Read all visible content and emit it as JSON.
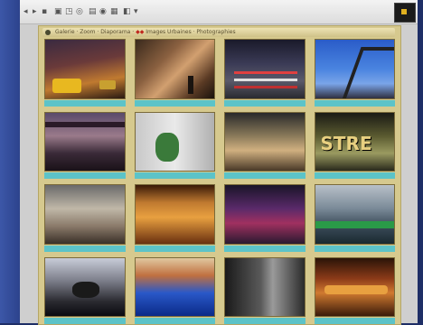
{
  "window": {
    "toolbar_icons": [
      "back-icon",
      "forward-icon",
      "stop-icon",
      "refresh-icon",
      "home-icon",
      "search-icon",
      "favorites-icon",
      "history-icon",
      "mail-icon",
      "print-icon",
      "chevron-down-icon"
    ],
    "logo_icon": "browser-logo-icon"
  },
  "gallery": {
    "address_text_prefix": "Galerie  ·  Zoom  ·  Diaporama  ·  ",
    "address_text_highlight": "◆◆",
    "address_text_suffix": "  Images Urbaines  ·  Photographies",
    "caption_color": "#5cc3c8",
    "frame_color": "#d6c98e",
    "thumbnails": [
      {
        "subject": "taxis-at-night"
      },
      {
        "subject": "pedestrian-street"
      },
      {
        "subject": "highway-traffic"
      },
      {
        "subject": "bridge-sky"
      },
      {
        "subject": "city-window-view"
      },
      {
        "subject": "building-facade-trees"
      },
      {
        "subject": "subway-platform"
      },
      {
        "subject": "street-sign"
      },
      {
        "subject": "cafe-interior"
      },
      {
        "subject": "shop-lights"
      },
      {
        "subject": "arcade-machines"
      },
      {
        "subject": "train-station"
      },
      {
        "subject": "airplane-engine"
      },
      {
        "subject": "blue-light-walkway"
      },
      {
        "subject": "dark-alley"
      },
      {
        "subject": "restaurant-bar"
      }
    ]
  }
}
